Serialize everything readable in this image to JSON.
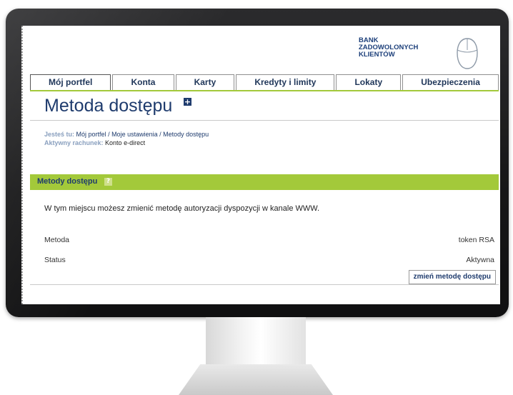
{
  "logo": {
    "line1": "BANK",
    "line2": "ZADOWOLONYCH",
    "line3": "KLIENTÓW"
  },
  "tabs": [
    {
      "label": "Mój portfel",
      "active": true
    },
    {
      "label": "Konta",
      "active": false
    },
    {
      "label": "Karty",
      "active": false
    },
    {
      "label": "Kredyty i limity",
      "active": false
    },
    {
      "label": "Lokaty",
      "active": false
    },
    {
      "label": "Ubezpieczenia",
      "active": false
    }
  ],
  "page": {
    "title": "Metoda dostępu",
    "plus_glyph": "+"
  },
  "breadcrumb": {
    "label": "Jesteś tu:",
    "path": "Mój portfel / Moje ustawienia / Metody dostępu",
    "account_label": "Aktywny rachunek:",
    "account_value": "Konto e-direct"
  },
  "section": {
    "title": "Metody dostępu",
    "help_glyph": "?"
  },
  "content": {
    "description": "W tym miejscu możesz zmienić metodę autoryzacji dyspozycji w kanale WWW.",
    "rows": [
      {
        "label": "Metoda",
        "value": "token RSA"
      },
      {
        "label": "Status",
        "value": "Aktywna"
      }
    ],
    "change_button": "zmień metodę dostępu"
  },
  "colors": {
    "brand": "#1e3b6d",
    "accent": "#a3c93a"
  },
  "icons": {
    "logo_mark": "mouse-icon",
    "title_action": "plus-icon",
    "section_help": "help-icon"
  }
}
